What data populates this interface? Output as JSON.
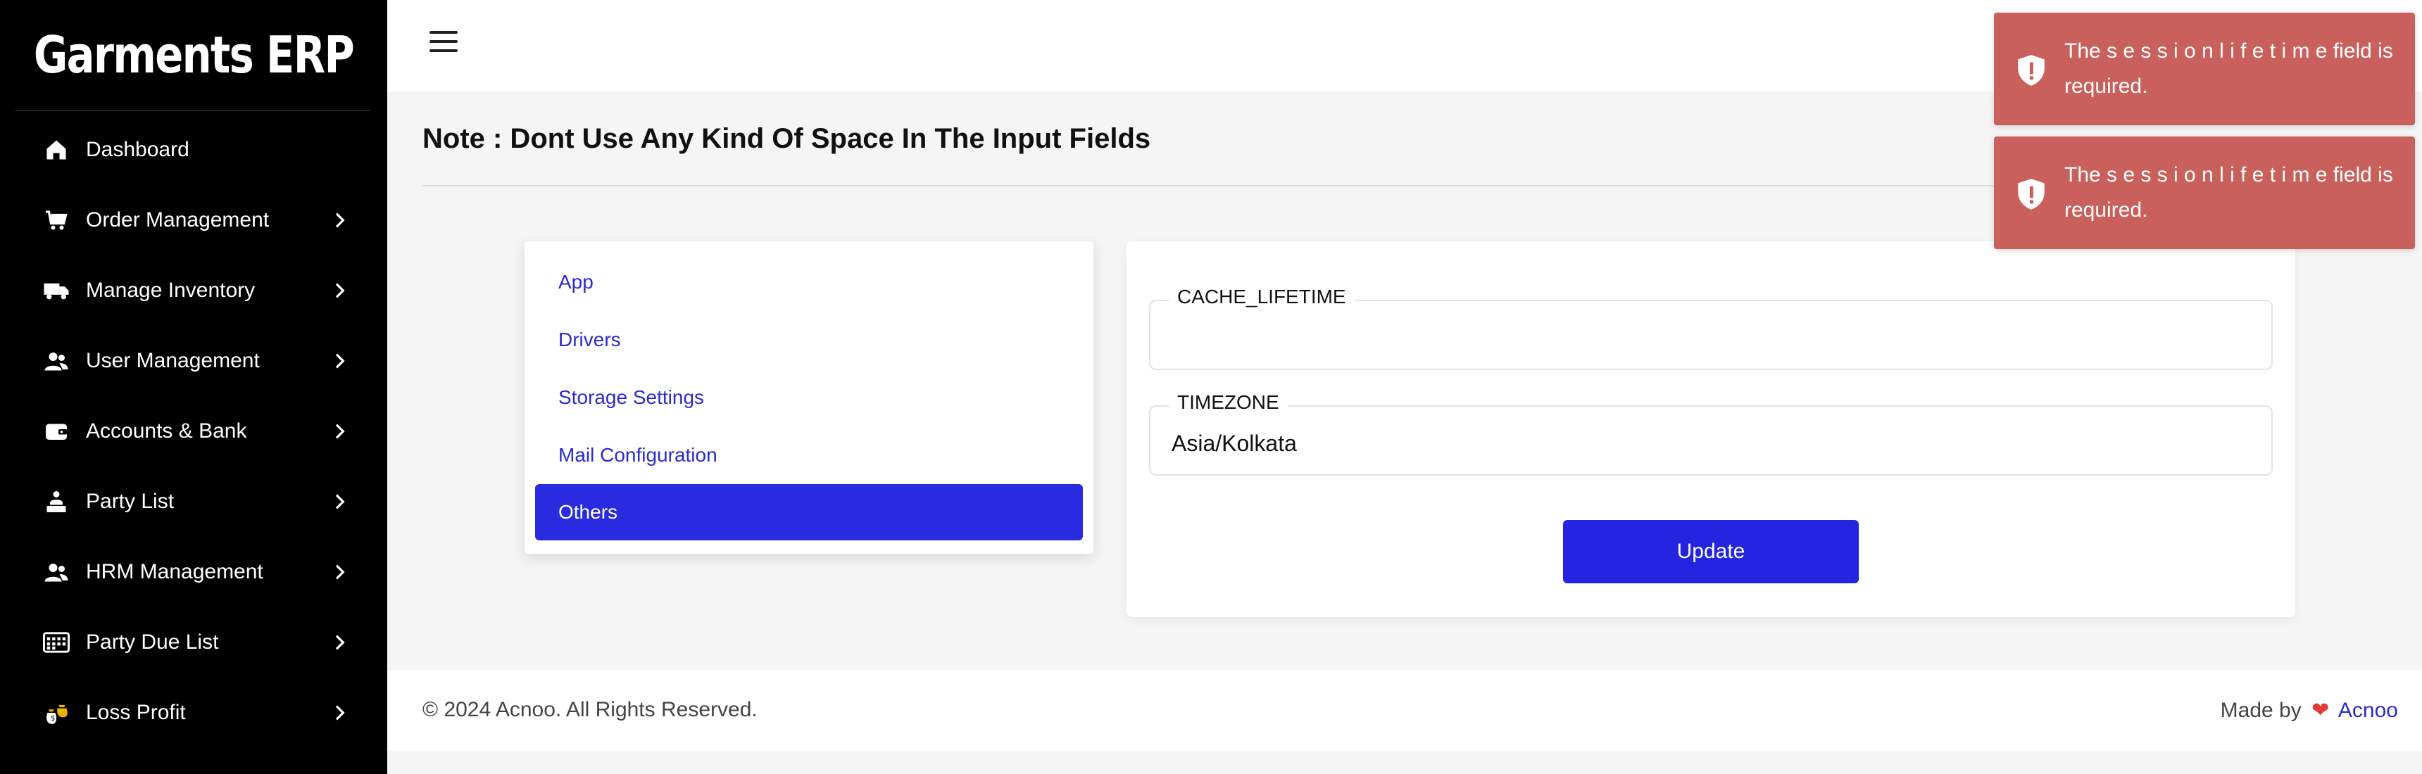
{
  "app": {
    "brand": "Garments ERP"
  },
  "sidebar": {
    "items": [
      {
        "label": "Dashboard",
        "icon": "home-icon",
        "has_children": false
      },
      {
        "label": "Order Management",
        "icon": "cart-icon",
        "has_children": true
      },
      {
        "label": "Manage Inventory",
        "icon": "truck-icon",
        "has_children": true
      },
      {
        "label": "User Management",
        "icon": "users-icon",
        "has_children": true
      },
      {
        "label": "Accounts & Bank",
        "icon": "wallet-icon",
        "has_children": true
      },
      {
        "label": "Party List",
        "icon": "party-icon",
        "has_children": true
      },
      {
        "label": "HRM Management",
        "icon": "users-icon",
        "has_children": true
      },
      {
        "label": "Party Due List",
        "icon": "calendar-icon",
        "has_children": true
      },
      {
        "label": "Loss Profit",
        "icon": "money-bag-icon",
        "has_children": true
      }
    ]
  },
  "topbar": {
    "notification_count": "0"
  },
  "page": {
    "note": "Note : Dont Use Any Kind Of Space In The Input Fields"
  },
  "settings": {
    "tabs": [
      {
        "label": "App",
        "active": false
      },
      {
        "label": "Drivers",
        "active": false
      },
      {
        "label": "Storage Settings",
        "active": false
      },
      {
        "label": "Mail Configuration",
        "active": false
      },
      {
        "label": "Others",
        "active": true
      }
    ],
    "fields": [
      {
        "label": "CACHE_LIFETIME",
        "value": ""
      },
      {
        "label": "TIMEZONE",
        "value": "Asia/Kolkata"
      }
    ],
    "update_label": "Update"
  },
  "footer": {
    "copyright": "© 2024 Acnoo. All Rights Reserved.",
    "made_by_prefix": "Made by",
    "made_by_link": "Acnoo"
  },
  "toasts": [
    {
      "message": "The s e s s i o n l i f e t i m e field is required.",
      "color": "#c9605c"
    },
    {
      "message": "The s e s s i o n l i f e t i m e field is required.",
      "color": "#c9605c"
    }
  ],
  "colors": {
    "accent": "#2a2ae0",
    "sidebar_bg": "#000000",
    "toast_bg": "#c9605c"
  }
}
